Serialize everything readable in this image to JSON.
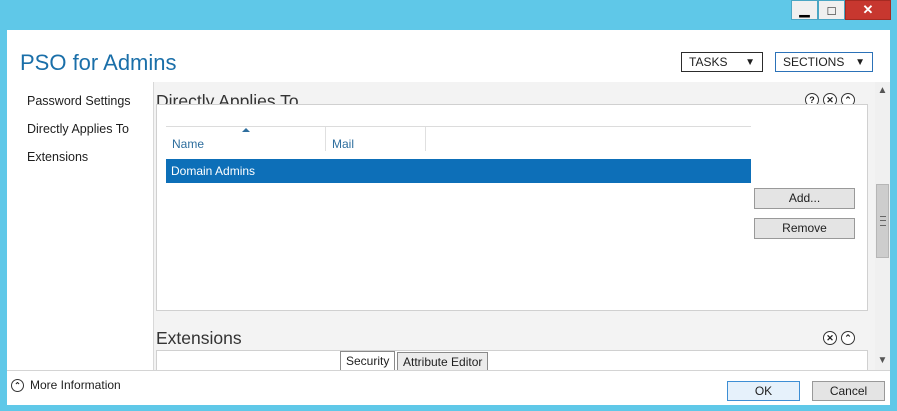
{
  "window_controls": {
    "minimize_symbol": "▁",
    "maximize_symbol": "□",
    "close_symbol": "✕"
  },
  "header": {
    "title": "PSO for Admins",
    "tasks_label": "TASKS",
    "sections_label": "SECTIONS"
  },
  "nav": {
    "items": [
      "Password Settings",
      "Directly Applies To",
      "Extensions"
    ]
  },
  "directly_applies": {
    "title": "Directly Applies To",
    "columns": [
      "Name",
      "Mail"
    ],
    "rows": [
      {
        "name": "Domain Admins",
        "mail": ""
      }
    ],
    "add_label": "Add...",
    "remove_label": "Remove"
  },
  "extensions": {
    "title": "Extensions",
    "tabs": [
      "Security",
      "Attribute Editor"
    ]
  },
  "footer": {
    "more_info": "More Information",
    "ok_label": "OK",
    "cancel_label": "Cancel"
  },
  "colors": {
    "accent": "#1a6fa9",
    "selection": "#0d6fb8",
    "frame": "#5fc8e8",
    "close": "#c7372f"
  }
}
